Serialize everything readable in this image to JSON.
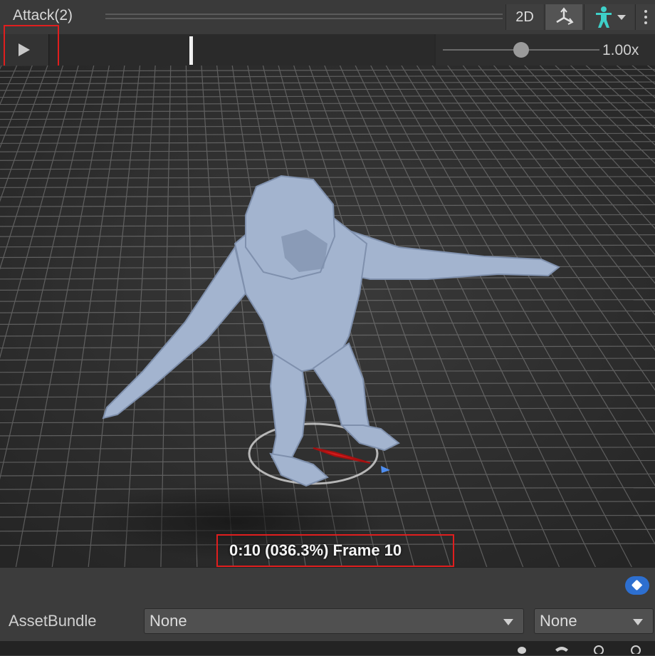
{
  "header": {
    "title": "Attack(2)",
    "mode_2d": "2D",
    "pivot_icon": "pivot-icon",
    "avatar_icon": "avatar-icon"
  },
  "timeline": {
    "playhead_fraction": 0.363,
    "speed": "1.00x",
    "speed_fraction": 0.5
  },
  "viewport": {
    "status": "0:10 (036.3%) Frame 10"
  },
  "bottom": {
    "assetbundle_label": "AssetBundle",
    "bundle_name": "None",
    "bundle_variant": "None"
  },
  "colors": {
    "highlight": "#e01e1e",
    "model": "#9fb2d0",
    "accent_blue": "#2d6fd0"
  }
}
